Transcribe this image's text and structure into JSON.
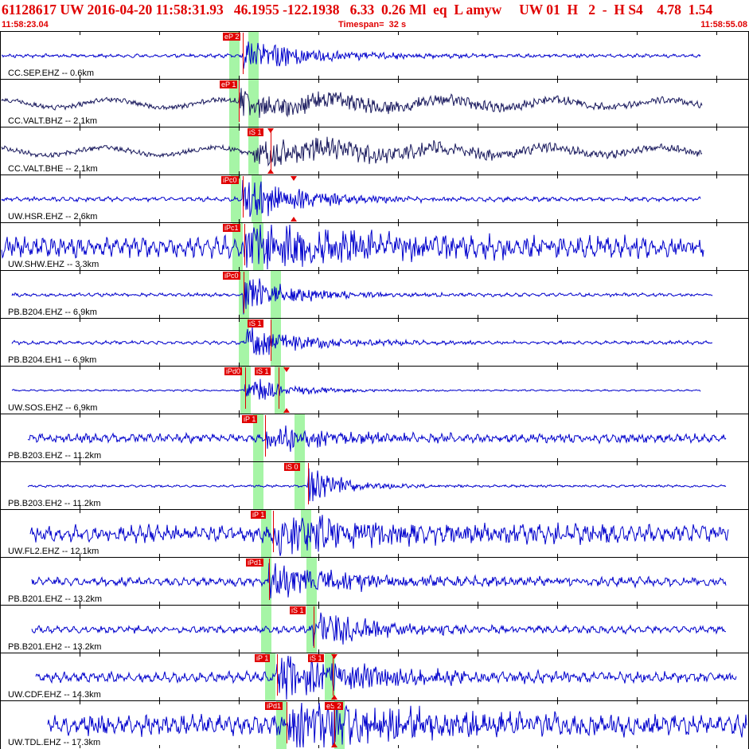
{
  "header": {
    "title": "61128617 UW 2016-04-20 11:58:31.93   46.1955 -122.1938   6.33  0.26 Ml  eq  L amyw     UW 01  H   2  -  H S4    4.78  1.54",
    "start_time": "11:58:23.04",
    "timespan": "Timespan=  32 s",
    "end_time": "11:58:55.08"
  },
  "colors": {
    "trace_blue": "#0000cc",
    "trace_dark": "#1a1a5e",
    "pick_red": "#e00000",
    "window_green": "#a6f5a6"
  },
  "traces": [
    {
      "label": "CC.SEP.EHZ -- 0.6km",
      "color": "trace_blue",
      "picks": [
        {
          "label": "eP 2",
          "type": "P"
        }
      ]
    },
    {
      "label": "CC.VALT.BHZ -- 2.1km",
      "color": "trace_dark",
      "picks": [
        {
          "label": "eP 1",
          "type": "P"
        }
      ]
    },
    {
      "label": "CC.VALT.BHE -- 2.1km",
      "color": "trace_dark",
      "picks": [
        {
          "label": "iS 1",
          "type": "S"
        }
      ]
    },
    {
      "label": "UW.HSR.EHZ -- 2.6km",
      "color": "trace_blue",
      "picks": [
        {
          "label": "iPc0",
          "type": "P"
        }
      ]
    },
    {
      "label": "UW.SHW.EHZ -- 3.3km",
      "color": "trace_blue",
      "picks": [
        {
          "label": "iPc1",
          "type": "P"
        }
      ]
    },
    {
      "label": "PB.B204.EHZ -- 6.9km",
      "color": "trace_blue",
      "picks": [
        {
          "label": "iPc0",
          "type": "P"
        }
      ]
    },
    {
      "label": "PB.B204.EH1 -- 6.9km",
      "color": "trace_blue",
      "picks": [
        {
          "label": "iS 1",
          "type": "S"
        }
      ]
    },
    {
      "label": "UW.SOS.EHZ -- 6.9km",
      "color": "trace_blue",
      "picks": [
        {
          "label": "iPd0",
          "type": "P"
        },
        {
          "label": "iS 1",
          "type": "S"
        }
      ]
    },
    {
      "label": "PB.B203.EHZ -- 11.2km",
      "color": "trace_blue",
      "picks": [
        {
          "label": "iP 1",
          "type": "P"
        }
      ]
    },
    {
      "label": "PB.B203.EH2 -- 11.2km",
      "color": "trace_blue",
      "picks": [
        {
          "label": "iS 0",
          "type": "S"
        }
      ]
    },
    {
      "label": "UW.FL2.EHZ -- 12.1km",
      "color": "trace_blue",
      "picks": [
        {
          "label": "iP 1",
          "type": "P"
        }
      ]
    },
    {
      "label": "PB.B201.EHZ -- 13.2km",
      "color": "trace_blue",
      "picks": [
        {
          "label": "iPd1",
          "type": "P"
        }
      ]
    },
    {
      "label": "PB.B201.EH2 -- 13.2km",
      "color": "trace_blue",
      "picks": [
        {
          "label": "iS 1",
          "type": "S"
        }
      ]
    },
    {
      "label": "UW.CDF.EHZ -- 14.3km",
      "color": "trace_blue",
      "picks": [
        {
          "label": "iP 1",
          "type": "P"
        },
        {
          "label": "iS 1",
          "type": "S"
        }
      ]
    },
    {
      "label": "UW.TDL.EHZ -- 17.3km",
      "color": "trace_blue",
      "picks": [
        {
          "label": "iPd1",
          "type": "P"
        },
        {
          "label": "eS 2",
          "type": "S"
        }
      ]
    }
  ]
}
